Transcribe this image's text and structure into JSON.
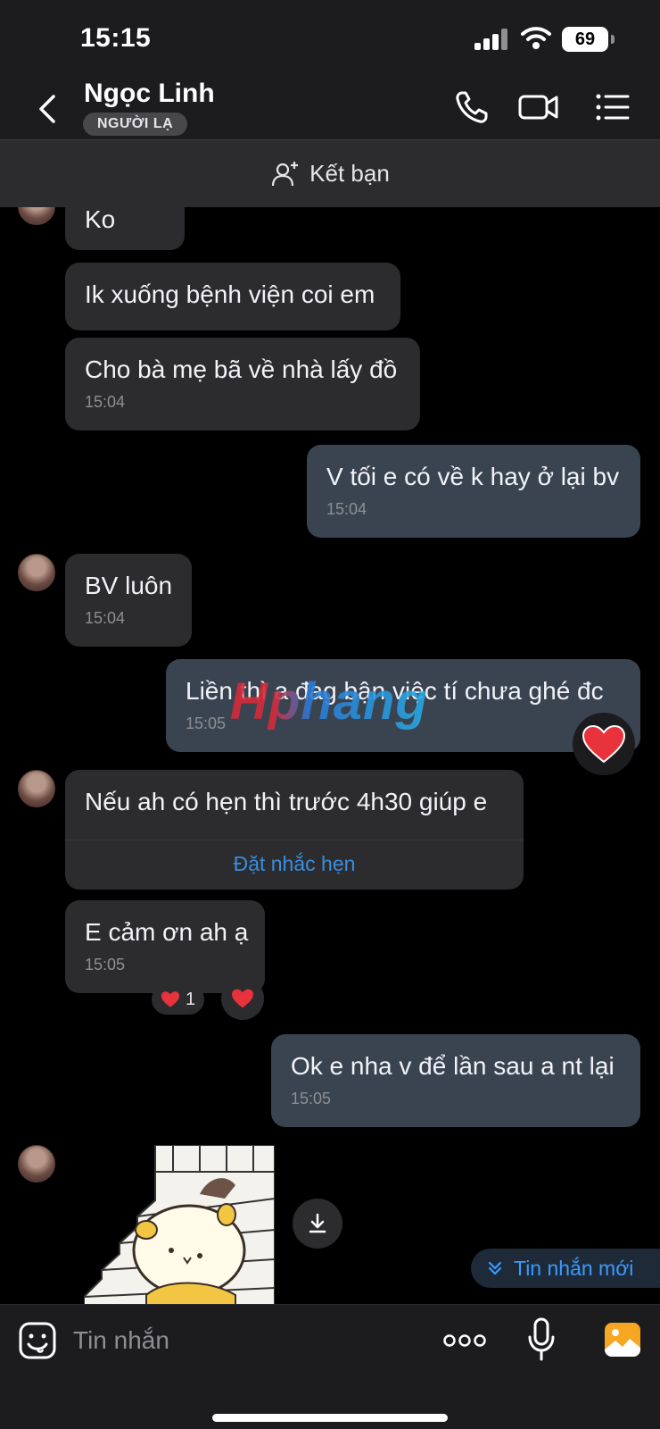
{
  "status_bar": {
    "time": "15:15",
    "battery": "69"
  },
  "header": {
    "contact_name": "Ngọc Linh",
    "badge": "NGƯỜI LẠ"
  },
  "friend_bar": {
    "label": "Kết bạn"
  },
  "messages": [
    {
      "direction": "in",
      "text": "Ko",
      "time": ""
    },
    {
      "direction": "in",
      "text": "Ik xuống bệnh viện coi em",
      "time": ""
    },
    {
      "direction": "in",
      "text": "Cho bà mẹ bã về nhà lấy đồ",
      "time": "15:04"
    },
    {
      "direction": "out",
      "text": "V tối e có về k hay ở lại bv",
      "time": "15:04"
    },
    {
      "direction": "in",
      "text": "BV luôn",
      "time": "15:04"
    },
    {
      "direction": "out",
      "text": "Liền thì a đag bận việc tí chưa ghé đc",
      "time": "15:05"
    },
    {
      "direction": "in",
      "text": "Nếu ah có hẹn thì trước 4h30 giúp e",
      "time": "",
      "action": "Đặt nhắc hẹn"
    },
    {
      "direction": "in",
      "text": "E cảm ơn ah ạ",
      "time": "15:05",
      "reaction_count": "1"
    },
    {
      "direction": "out",
      "text": "Ok e nha v để lần sau a nt lại",
      "time": "15:05"
    }
  ],
  "watermark": "Hphang",
  "new_messages_label": "Tin nhắn mới",
  "composer": {
    "placeholder": "Tin nhắn"
  },
  "colors": {
    "bubble_in": "#2c2c2e",
    "bubble_out": "#3a4451",
    "link": "#3a8dde",
    "accent_orange": "#f5a623"
  }
}
